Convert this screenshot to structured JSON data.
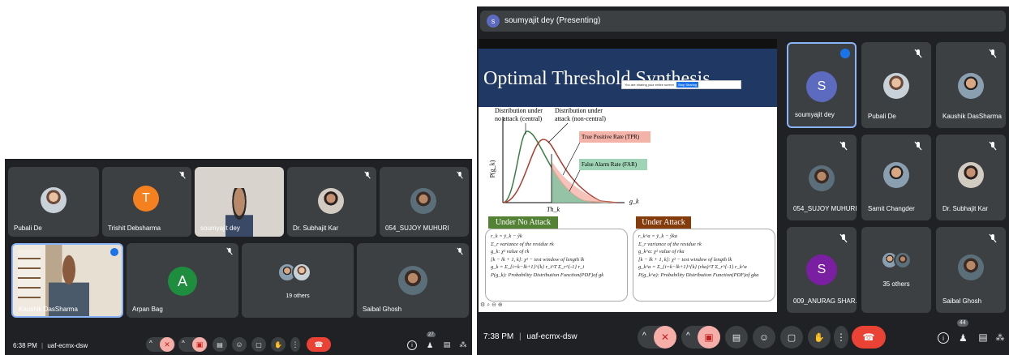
{
  "left_call": {
    "tiles": [
      {
        "name": "Pubali De",
        "muted": false
      },
      {
        "name": "Trishit Debsharma",
        "initial": "T",
        "color": "#f4801f",
        "muted": true
      },
      {
        "name": "soumyajit dey",
        "muted": false
      },
      {
        "name": "Dr. Subhajit Kar",
        "muted": true
      },
      {
        "name": "054_SUJOY MUHURI",
        "muted": true
      },
      {
        "name": "Kaushik DasSharma",
        "muted": false
      },
      {
        "name": "Arpan Bag",
        "initial": "A",
        "color": "#1e8e3e",
        "muted": true
      },
      {
        "name": "19 others"
      },
      {
        "name": "Saibal Ghosh",
        "muted": true
      }
    ],
    "bottom": {
      "time": "6:38 PM",
      "separator": "|",
      "meeting_code": "uaf-ecmx-dsw",
      "participants_count": "27"
    }
  },
  "right_call": {
    "presenter_label": "soumyajit dey (Presenting)",
    "presenter_initial": "s",
    "slide": {
      "title": "Optimal Threshold Synthesis",
      "share_banner": {
        "text": "You are sharing your entire screen",
        "button": "Stop Sharing"
      },
      "dist_central": "Distribution under no attack (central)",
      "dist_noncentral": "Distribution under attack (non-central)",
      "tpr": "True Positive Rate (TPR)",
      "far": "False Alarm Rate (FAR)",
      "y_axis": "P(g_k)",
      "x_axis": "g_k",
      "threshold": "Th_k",
      "no_attack_title": "Under No Attack",
      "no_attack_lines": [
        "r_k = ȳ_k − ŷk",
        "Σ_r variance of the residue rk",
        "g_k: χ² value of rk",
        "[k − lk + 1, k]: χ² − test window of length lk",
        "g_k = Σ_{i=k−lk+1}^{k} r_i^T Σ_r^{-1} r_i",
        "P(g_k): Probability Distribution Function(PDF)of gk"
      ],
      "attack_title": "Under Attack",
      "attack_lines": [
        "r_k^a = ȳ_k − ŷka",
        "Σ_r variance of the residue rk",
        "g_k^a: χ² value of rka",
        "[k − lk + 1, k]: χ² − test window of length lk",
        "g_k^a = Σ_{i=k−lk+1}^{k} (rka)^T Σ_r^{-1} r_k^a",
        "P(g_k^a): Probability Distribution Function(PDF)of gka"
      ]
    },
    "tiles": [
      {
        "name": "soumyajit dey",
        "initial": "S",
        "color": "#5c6bc0",
        "speaking": true
      },
      {
        "name": "Pubali De",
        "muted": true
      },
      {
        "name": "Kaushik DasSharma",
        "muted": true
      },
      {
        "name": "054_SUJOY MUHURI",
        "muted": true
      },
      {
        "name": "Samit Changder",
        "muted": true
      },
      {
        "name": "Dr. Subhajit Kar",
        "muted": true
      },
      {
        "name": "009_ANURAG SHAR...",
        "initial": "S",
        "color": "#7b1fa2",
        "muted": true
      },
      {
        "name": "35 others"
      },
      {
        "name": "Saibal Ghosh",
        "muted": true
      }
    ],
    "bottom": {
      "time": "7:38 PM",
      "separator": "|",
      "meeting_code": "uaf-ecmx-dsw",
      "participants_count": "44"
    }
  }
}
